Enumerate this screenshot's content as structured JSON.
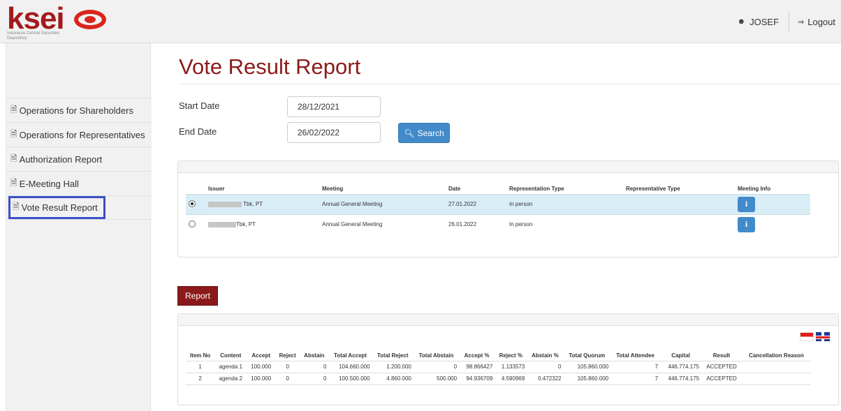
{
  "header": {
    "logo": {
      "text": "ksei",
      "subtitle": "Indonesia Central Securities Depository"
    },
    "user_name": "JOSEF",
    "logout_label": "Logout",
    "icons": {
      "user": "user-icon",
      "logout": "logout-icon"
    }
  },
  "sidebar": {
    "items": [
      {
        "label": "Operations for Shareholders",
        "icon": "document-icon"
      },
      {
        "label": "Operations for Representatives",
        "icon": "document-icon"
      },
      {
        "label": "Authorization Report",
        "icon": "document-icon"
      },
      {
        "label": "E-Meeting Hall",
        "icon": "document-icon"
      },
      {
        "label": "Vote Result Report",
        "icon": "document-icon",
        "active": true
      }
    ]
  },
  "main": {
    "title": "Vote Result Report",
    "start_date_label": "Start Date",
    "start_date_value": "28/12/2021",
    "end_date_label": "End Date",
    "end_date_value": "26/02/2022",
    "search_label": "Search",
    "report_label": "Report"
  },
  "meetings": {
    "columns": [
      "Issuer",
      "Meeting",
      "Date",
      "Representation Type",
      "Representative Type",
      "Meeting Info"
    ],
    "rows": [
      {
        "selected": true,
        "issuer": "Tbk, PT",
        "meeting": "Annual General Meeting",
        "date": "27.01.2022",
        "representation_type": "In person",
        "representative_type": ""
      },
      {
        "selected": false,
        "issuer": "Tbk, PT",
        "meeting": "Annual General Meeting",
        "date": "26.01.2022",
        "representation_type": "In person",
        "representative_type": ""
      }
    ]
  },
  "results": {
    "flags": [
      "indonesia-flag",
      "uk-flag"
    ],
    "columns": [
      "Item No",
      "Content",
      "Accept",
      "Reject",
      "Abstain",
      "Total Accept",
      "Total Reject",
      "Total Abstain",
      "Accept %",
      "Reject %",
      "Abstain %",
      "Total Quorum",
      "Total Attendee",
      "Capital",
      "Result",
      "Cancellation Reason"
    ],
    "rows": [
      {
        "item_no": "1",
        "content": "agenda 1",
        "accept": "100.000",
        "reject": "0",
        "abstain": "0",
        "total_accept": "104.660.000",
        "total_reject": "1.200.000",
        "total_abstain": "0",
        "accept_pct": "98.866427",
        "reject_pct": "1.133573",
        "abstain_pct": "0",
        "total_quorum": "105.860.000",
        "total_attendee": "7",
        "capital": "446.774.175",
        "result": "ACCEPTED",
        "cancellation_reason": ""
      },
      {
        "item_no": "2",
        "content": "agenda 2",
        "accept": "100.000",
        "reject": "0",
        "abstain": "0",
        "total_accept": "100.500.000",
        "total_reject": "4.860.000",
        "total_abstain": "500.000",
        "accept_pct": "94.936709",
        "reject_pct": "4.590969",
        "abstain_pct": "0.472322",
        "total_quorum": "105.860.000",
        "total_attendee": "7",
        "capital": "446.774.175",
        "result": "ACCEPTED",
        "cancellation_reason": ""
      }
    ]
  },
  "colors": {
    "brand": "#8b1a1a",
    "primary_button": "#428bca",
    "selected_row": "#d9edf7",
    "active_outline": "#3b4fc6"
  }
}
